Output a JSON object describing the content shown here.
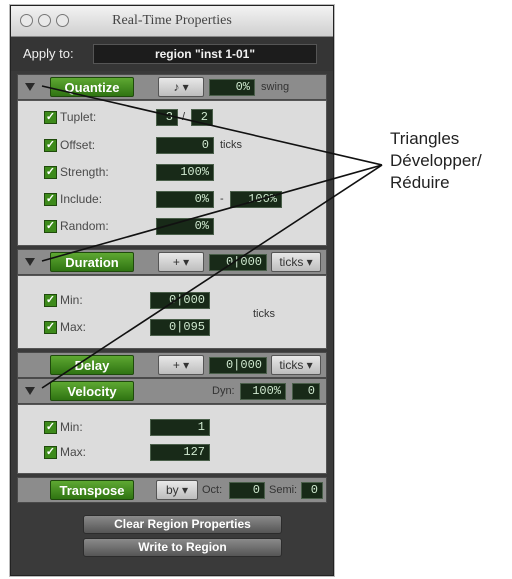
{
  "window": {
    "title": "Real-Time Properties"
  },
  "apply": {
    "label": "Apply to:",
    "value": "region \"inst 1-01\""
  },
  "quantize": {
    "button": "Quantize",
    "value": "0%",
    "swing_label": "swing",
    "rows": [
      {
        "label": "Tuplet:",
        "v1": "3",
        "sep": "/",
        "v2": "2"
      },
      {
        "label": "Offset:",
        "v1": "0",
        "unit": "ticks"
      },
      {
        "label": "Strength:",
        "v1": "100%"
      },
      {
        "label": "Include:",
        "v1": "0%",
        "sep": "-",
        "v2": "100%"
      },
      {
        "label": "Random:",
        "v1": "0%"
      }
    ]
  },
  "duration": {
    "button": "Duration",
    "mode": "+",
    "value": "0|000",
    "unit": "ticks",
    "rows": [
      {
        "label": "Min:",
        "v1": "0|000"
      },
      {
        "label": "Max:",
        "v1": "0|095"
      }
    ],
    "ticks_label": "ticks"
  },
  "delay": {
    "button": "Delay",
    "mode": "+",
    "value": "0|000",
    "unit": "ticks"
  },
  "velocity": {
    "button": "Velocity",
    "dyn_label": "Dyn:",
    "dyn_value": "100%",
    "extra_value": "0",
    "rows": [
      {
        "label": "Min:",
        "v1": "1"
      },
      {
        "label": "Max:",
        "v1": "127"
      }
    ]
  },
  "transpose": {
    "button": "Transpose",
    "mode": "by",
    "oct_label": "Oct:",
    "oct_value": "0",
    "semi_label": "Semi:",
    "semi_value": "0"
  },
  "actions": {
    "clear": "Clear Region Properties",
    "write": "Write to Region"
  },
  "callout": {
    "line1": "Triangles",
    "line2": "Développer/",
    "line3": "Réduire"
  },
  "colors": {
    "accent_green": "#3d8a1b",
    "panel": "#3a3a3a"
  }
}
